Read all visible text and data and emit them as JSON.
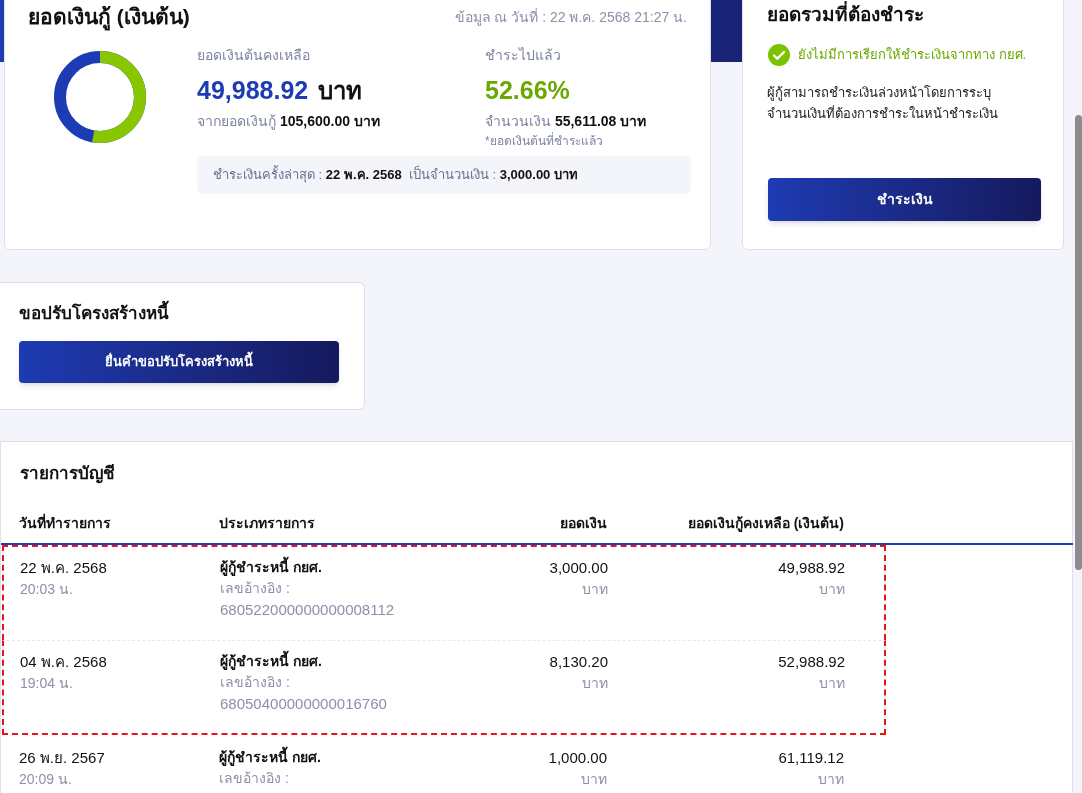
{
  "loan_card": {
    "title": "ยอดเงินกู้ (เงินต้น)",
    "as_of": "ข้อมูล ณ วันที่ : 22 พ.ค. 2568 21:27 น.",
    "donut": {
      "level": 0.5266
    },
    "remaining_label": "ยอดเงินต้นคงเหลือ",
    "remaining_amount": "49,988.92",
    "remaining_unit": "บาท",
    "loan_total": "จากยอดเงินกู้ **105,600.00 บาท**",
    "paid_label": "ชำระไปแล้ว",
    "paid_percent": "52.66%",
    "paid_amount": "จำนวนเงิน **55,611.08 บาท**",
    "paid_note": "*ยอดเงินต้นที่ชำระแล้ว",
    "last_payment": "ชำระเงินครั้งล่าสุด : **22 พ.ค. 2568**  เป็นจำนวนเงิน : **3,000.00 บาท**"
  },
  "due_card": {
    "title": "ยอดรวมที่ต้องชำระ",
    "status": "ยังไม่มีการเรียกให้ชำระเงินจากทาง กยศ.",
    "description": "ผู้กู้สามารถชำระเงินล่วงหน้าโดยการระบุจำนวนเงินที่ต้องการชำระในหน้าชำระเงิน",
    "button": "ชำระเงิน"
  },
  "restructure_card": {
    "title": "ขอปรับโครงสร้างหนี้",
    "button": "ยื่นคำขอปรับโครงสร้างหนี้"
  },
  "table": {
    "title": "รายการบัญชี",
    "columns": [
      "วันที่ทำรายการ",
      "ประเภทรายการ",
      "ยอดเงิน",
      "ยอดเงินกู้คงเหลือ (เงินต้น)"
    ],
    "rows": [
      {
        "date": "22 พ.ค. 2568",
        "time": "20:03 น.",
        "type": "ผู้กู้ชำระหนี้ กยศ.",
        "ref_label": "เลขอ้างอิง :",
        "ref": "680522000000000008112",
        "amount": "3,000.00",
        "amount_unit": "บาท",
        "balance": "49,988.92",
        "balance_unit": "บาท",
        "highlighted": true
      },
      {
        "date": "04 พ.ค. 2568",
        "time": "19:04 น.",
        "type": "ผู้กู้ชำระหนี้ กยศ.",
        "ref_label": "เลขอ้างอิง :",
        "ref": "68050400000000016760",
        "amount": "8,130.20",
        "amount_unit": "บาท",
        "balance": "52,988.92",
        "balance_unit": "บาท",
        "highlighted": true
      },
      {
        "date": "26 พ.ย. 2567",
        "time": "20:09 น.",
        "type": "ผู้กู้ชำระหนี้ กยศ.",
        "ref_label": "เลขอ้างอิง :",
        "amount": "1,000.00",
        "amount_unit": "บาท",
        "balance": "61,119.12",
        "balance_unit": "บาท",
        "highlighted": false
      }
    ]
  }
}
